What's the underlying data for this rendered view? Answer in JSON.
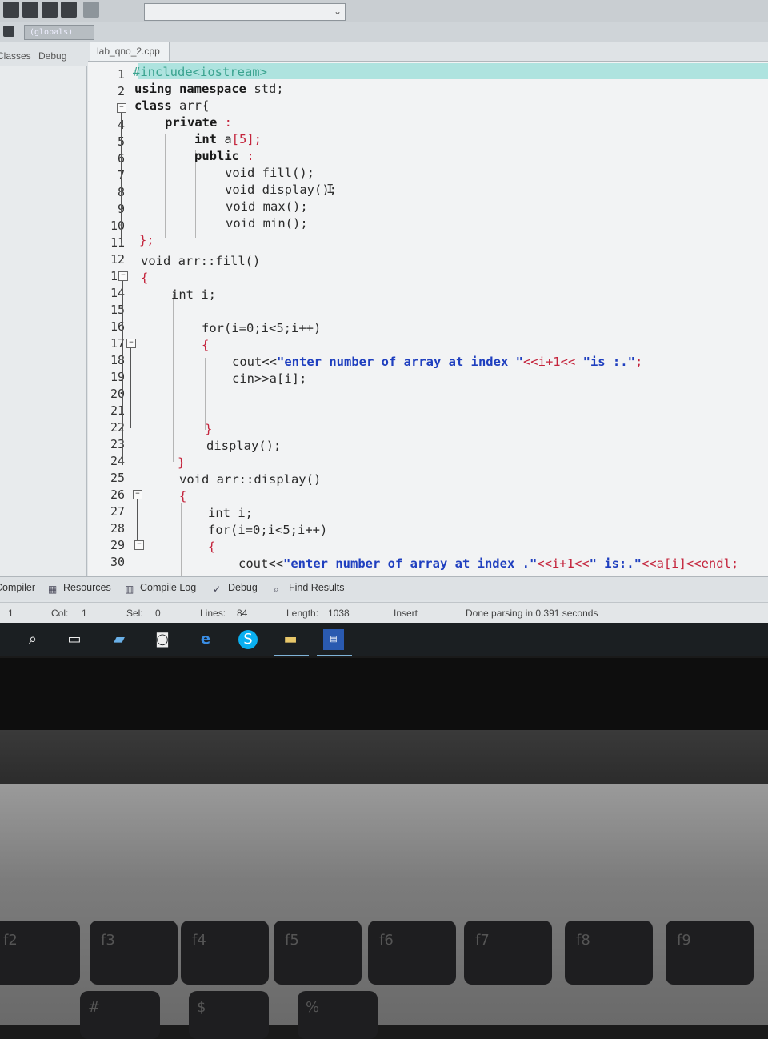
{
  "ide": {
    "scope_dropdown": "(globals)",
    "left_tabs": [
      "Classes",
      "Debug"
    ],
    "file_tab": "lab_qno_2.cpp"
  },
  "editor": {
    "line_numbers": [
      "1",
      "2",
      "3",
      "4",
      "5",
      "6",
      "7",
      "8",
      "9",
      "10",
      "11",
      "12",
      "13",
      "14",
      "15",
      "16",
      "17",
      "18",
      "19",
      "20",
      "21",
      "22",
      "23",
      "24",
      "25",
      "26",
      "27",
      "28",
      "29",
      "30"
    ],
    "code": {
      "l1": "#include<iostream>",
      "l2_kw": "using namespace",
      "l2_rest": " std;",
      "l3_kw": "class",
      "l3_rest": " arr{",
      "l4_kw": "private",
      "l4_rest": " :",
      "l5_kw": "int",
      "l5_rest": " a",
      "l5_idx": "[5];",
      "l6_kw": "public",
      "l6_rest": " :",
      "l7": "void fill();",
      "l8": "void display();",
      "l9": "void max();",
      "l10": "void min();",
      "l11": "};",
      "l12": "void arr::fill()",
      "l13": "{",
      "l14": "int i;",
      "l16": "for(i=0;i<5;i++)",
      "l17": "{",
      "l18_a": "cout<<",
      "l18_s": "\"enter number of array at index \"",
      "l18_b": "<<i+1<< ",
      "l18_s2": "\"is :.\"",
      "l18_c": ";",
      "l19": "cin>>a[i];",
      "l22": "}",
      "l23": "display();",
      "l24": "}",
      "l25": "void arr::display()",
      "l26": "{",
      "l27": "int i;",
      "l28": "for(i=0;i<5;i++)",
      "l29": "{",
      "l30_a": "cout<<",
      "l30_s": "\"enter number of array at index .\"",
      "l30_b": "<<i+1<<",
      "l30_s2": "\" is:.\"",
      "l30_c": "<<a[i]<<endl;"
    }
  },
  "bottom_tabs": [
    "Compiler",
    "Resources",
    "Compile Log",
    "Debug",
    "Find Results"
  ],
  "status_bar": {
    "line": "1",
    "col_label": "Col:",
    "col": "1",
    "sel_label": "Sel:",
    "sel": "0",
    "lines_label": "Lines:",
    "lines": "84",
    "length_label": "Length:",
    "length": "1038",
    "mode": "Insert",
    "message": "Done parsing in 0.391 seconds"
  },
  "keyboard": {
    "f_keys": [
      "f2",
      "f3",
      "f4",
      "f5",
      "f6",
      "f7",
      "f8",
      "f9"
    ],
    "lower_keys": [
      "#",
      "$",
      "%"
    ]
  },
  "colors": {
    "keyword": "#1a1a1a",
    "string": "#1f3fbf",
    "symbol": "#c4243c",
    "preprocessor": "#3aa38f",
    "highlight_line": "#aee3df"
  }
}
